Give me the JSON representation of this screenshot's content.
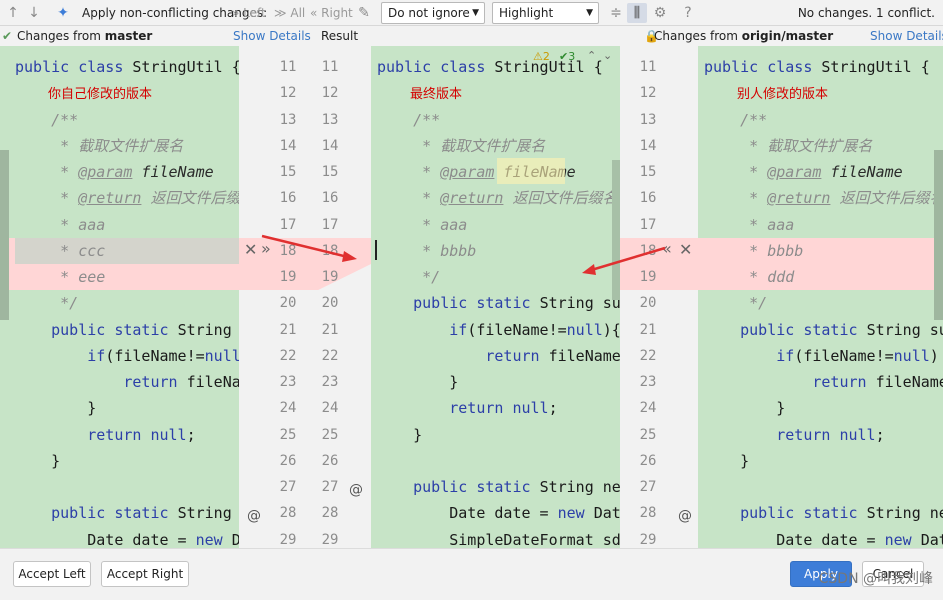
{
  "toolbar": {
    "apply_label": "Apply non-conflicting changes:",
    "left": "Left",
    "all": "All",
    "right": "Right",
    "ignore_select": "Do not ignore",
    "highlight_select": "Highlight words",
    "status": "No changes. 1 conflict."
  },
  "headers": {
    "left_prefix": "Changes from",
    "left_branch": "master",
    "left_link": "Show Details",
    "result": "Result",
    "right_prefix": "Changes from",
    "right_branch": "origin/master",
    "right_link": "Show Details"
  },
  "result_badges": {
    "warnings": "2",
    "ok": "3"
  },
  "line_numbers": [
    "11",
    "12",
    "13",
    "14",
    "15",
    "16",
    "17",
    "18",
    "19",
    "20",
    "21",
    "22",
    "23",
    "24",
    "25",
    "26",
    "27",
    "28",
    "29"
  ],
  "left_pane": {
    "lines": [
      [
        [
          "kw",
          "public class "
        ],
        [
          "t",
          "StringUtil {"
        ]
      ],
      [
        [
          "red",
          "        你自己修改的版本"
        ]
      ],
      [
        [
          "cm",
          "    /**"
        ]
      ],
      [
        [
          "cm",
          "     * 截取文件扩展名"
        ]
      ],
      [
        [
          "cm",
          "     * "
        ],
        [
          "ann",
          "@param"
        ],
        [
          "pr",
          " fileName"
        ]
      ],
      [
        [
          "cm",
          "     * "
        ],
        [
          "ann",
          "@return"
        ],
        [
          "cm",
          " 返回文件后缀名"
        ]
      ],
      [
        [
          "cm",
          "     * aaa"
        ]
      ],
      [
        [
          "cm",
          "     * ccc"
        ]
      ],
      [
        [
          "cm",
          "     * eee"
        ]
      ],
      [
        [
          "cm",
          "     */"
        ]
      ],
      [
        [
          "kw",
          "    public static "
        ],
        [
          "t",
          "String "
        ]
      ],
      [
        [
          "kw",
          "        if"
        ],
        [
          "t",
          "(fileName!="
        ],
        [
          "kw",
          "null"
        ]
      ],
      [
        [
          "kw",
          "            return "
        ],
        [
          "t",
          "fileNa"
        ]
      ],
      [
        [
          "t",
          "        }"
        ]
      ],
      [
        [
          "kw",
          "        return null"
        ],
        [
          "t",
          ";"
        ]
      ],
      [
        [
          "t",
          "    }"
        ]
      ],
      [
        [
          "t",
          ""
        ]
      ],
      [
        [
          "kw",
          "    public static "
        ],
        [
          "t",
          "String r"
        ]
      ],
      [
        [
          "t",
          "        Date date = "
        ],
        [
          "kw",
          "new "
        ],
        [
          "t",
          "Da"
        ]
      ]
    ]
  },
  "result_pane": {
    "lines": [
      [
        [
          "kw",
          "public class "
        ],
        [
          "t",
          "StringUtil {"
        ]
      ],
      [
        [
          "red",
          "        最终版本"
        ]
      ],
      [
        [
          "cm",
          "    /**"
        ]
      ],
      [
        [
          "cm",
          "     * 截取文件扩展名"
        ]
      ],
      [
        [
          "cm",
          "     * "
        ],
        [
          "ann",
          "@param"
        ],
        [
          "pr",
          " fileName"
        ]
      ],
      [
        [
          "cm",
          "     * "
        ],
        [
          "ann",
          "@return"
        ],
        [
          "cm",
          " 返回文件后缀名"
        ]
      ],
      [
        [
          "cm",
          "     * aaa"
        ]
      ],
      [
        [
          "cm",
          "     * bbbb"
        ]
      ],
      [
        [
          "cm",
          "     */"
        ]
      ],
      [
        [
          "kw",
          "    public static "
        ],
        [
          "t",
          "String su"
        ]
      ],
      [
        [
          "kw",
          "        if"
        ],
        [
          "t",
          "(fileName!="
        ],
        [
          "kw",
          "null"
        ],
        [
          "t",
          "){"
        ]
      ],
      [
        [
          "kw",
          "            return "
        ],
        [
          "t",
          "fileName"
        ]
      ],
      [
        [
          "t",
          "        }"
        ]
      ],
      [
        [
          "kw",
          "        return null"
        ],
        [
          "t",
          ";"
        ]
      ],
      [
        [
          "t",
          "    }"
        ]
      ],
      [
        [
          "t",
          ""
        ]
      ],
      [
        [
          "kw",
          "    public static "
        ],
        [
          "t",
          "String new"
        ]
      ],
      [
        [
          "t",
          "        Date date = "
        ],
        [
          "kw",
          "new "
        ],
        [
          "t",
          "Date"
        ]
      ],
      [
        [
          "t",
          "        SimpleDateFormat sdf"
        ]
      ]
    ]
  },
  "right_pane": {
    "lines": [
      [
        [
          "kw",
          "public class "
        ],
        [
          "t",
          "StringUtil {"
        ]
      ],
      [
        [
          "red",
          "        别人修改的版本"
        ]
      ],
      [
        [
          "cm",
          "    /**"
        ]
      ],
      [
        [
          "cm",
          "     * 截取文件扩展名"
        ]
      ],
      [
        [
          "cm",
          "     * "
        ],
        [
          "ann",
          "@param"
        ],
        [
          "pr",
          " fileName"
        ]
      ],
      [
        [
          "cm",
          "     * "
        ],
        [
          "ann",
          "@return"
        ],
        [
          "cm",
          " 返回文件后缀名"
        ]
      ],
      [
        [
          "cm",
          "     * aaa"
        ]
      ],
      [
        [
          "cm",
          "     * bbbb"
        ]
      ],
      [
        [
          "cm",
          "     * ddd"
        ]
      ],
      [
        [
          "cm",
          "     */"
        ]
      ],
      [
        [
          "kw",
          "    public static "
        ],
        [
          "t",
          "String su"
        ]
      ],
      [
        [
          "kw",
          "        if"
        ],
        [
          "t",
          "(fileName!="
        ],
        [
          "kw",
          "null"
        ],
        [
          "t",
          ")"
        ]
      ],
      [
        [
          "kw",
          "            return "
        ],
        [
          "t",
          "fileName"
        ]
      ],
      [
        [
          "t",
          "        }"
        ]
      ],
      [
        [
          "kw",
          "        return null"
        ],
        [
          "t",
          ";"
        ]
      ],
      [
        [
          "t",
          "    }"
        ]
      ],
      [
        [
          "t",
          ""
        ]
      ],
      [
        [
          "kw",
          "    public static "
        ],
        [
          "t",
          "String ne"
        ]
      ],
      [
        [
          "t",
          "        Date date = "
        ],
        [
          "kw",
          "new "
        ],
        [
          "t",
          "Date"
        ]
      ]
    ]
  },
  "footer": {
    "accept_left": "Accept Left",
    "accept_right": "Accept Right",
    "apply": "Apply",
    "cancel": "Cancel",
    "watermark": "CSDN @叫我刘峰"
  },
  "colors": {
    "code_bg": "#c7e4c7",
    "conflict": "#ffd6d6",
    "accent": "#3d7dd8",
    "arrow": "#e03030"
  }
}
